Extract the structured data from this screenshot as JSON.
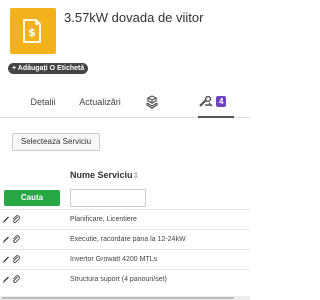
{
  "header": {
    "title": "3.57kW dovada de viitor",
    "thumbnail_color": "#f2b21b",
    "thumbnail_icon": "document-dollar-icon"
  },
  "tag_button": {
    "label": "+ Adăugați O Etichetă"
  },
  "tabs": [
    {
      "label": "Detalii"
    },
    {
      "label": "Actualizări"
    },
    {
      "icon": "boxes-icon"
    },
    {
      "icon": "tools-icon",
      "badge": "4"
    }
  ],
  "select_service_label": "Selecteaza Serviciu",
  "table": {
    "column_header": "Nume Serviciu",
    "sort_glyph": "⇳",
    "search_button": "Cauta",
    "search_placeholder": "",
    "rows": [
      {
        "name": "Planificare, Licentiere"
      },
      {
        "name": "Executie, racordare pana la 12-24kW"
      },
      {
        "name": "Invertor Growatt 4200 MTLs"
      },
      {
        "name": "Structura suport (4 panouri/set)"
      }
    ]
  },
  "colors": {
    "accent_green": "#28a745",
    "badge_purple": "#6f42c1"
  }
}
